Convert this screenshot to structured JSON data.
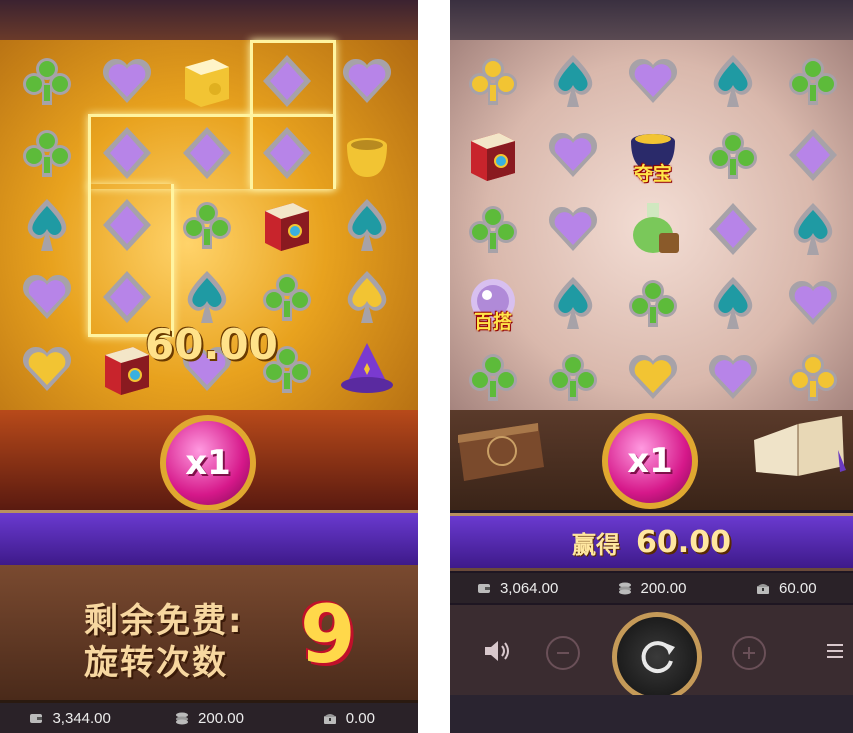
{
  "left_panel": {
    "win_amount": "60.00",
    "multiplier": "x1",
    "free_spins_label_line1": "剩余免费:",
    "free_spins_label_line2": "旋转次数",
    "free_spins_remaining": "9",
    "status": {
      "balance": "3,344.00",
      "bet": "200.00",
      "win": "0.00"
    },
    "grid": [
      [
        "club-green",
        "heart-purple",
        "book-gold",
        "diamond-purple",
        "heart-purple"
      ],
      [
        "club-green",
        "diamond-purple",
        "diamond-purple",
        "diamond-purple",
        "cauldron-gold"
      ],
      [
        "spade-teal",
        "diamond-purple",
        "club-green",
        "book-red",
        "spade-teal"
      ],
      [
        "heart-purple",
        "diamond-purple",
        "spade-teal",
        "club-green",
        "spade-gold"
      ],
      [
        "heart-gold",
        "book-red",
        "heart-purple",
        "club-green",
        "wizard-hat"
      ]
    ]
  },
  "right_panel": {
    "multiplier": "x1",
    "win_label": "赢得",
    "win_value": "60.00",
    "status": {
      "balance": "3,064.00",
      "bet": "200.00",
      "win": "60.00"
    },
    "grid": [
      [
        "club-gold",
        "spade-teal",
        "heart-purple",
        "spade-teal",
        "club-green"
      ],
      [
        "book-red",
        "heart-purple",
        "cauldron-treasure",
        "club-green",
        "diamond-purple"
      ],
      [
        "club-green",
        "heart-purple",
        "potion-green",
        "diamond-purple",
        "spade-teal"
      ],
      [
        "orb-wild",
        "spade-teal",
        "club-green",
        "spade-teal",
        "heart-purple"
      ],
      [
        "club-green",
        "club-green",
        "heart-gold",
        "heart-purple",
        "club-gold"
      ]
    ],
    "symbol_labels": {
      "cauldron-treasure": "夺宝",
      "orb-wild": "百搭"
    }
  },
  "colors": {
    "green": "#5dbb3a",
    "purple": "#b784e8",
    "teal": "#1f9aa3",
    "gold": "#f2c433",
    "silver": "#a7a2a8",
    "red": "#c8242c"
  }
}
